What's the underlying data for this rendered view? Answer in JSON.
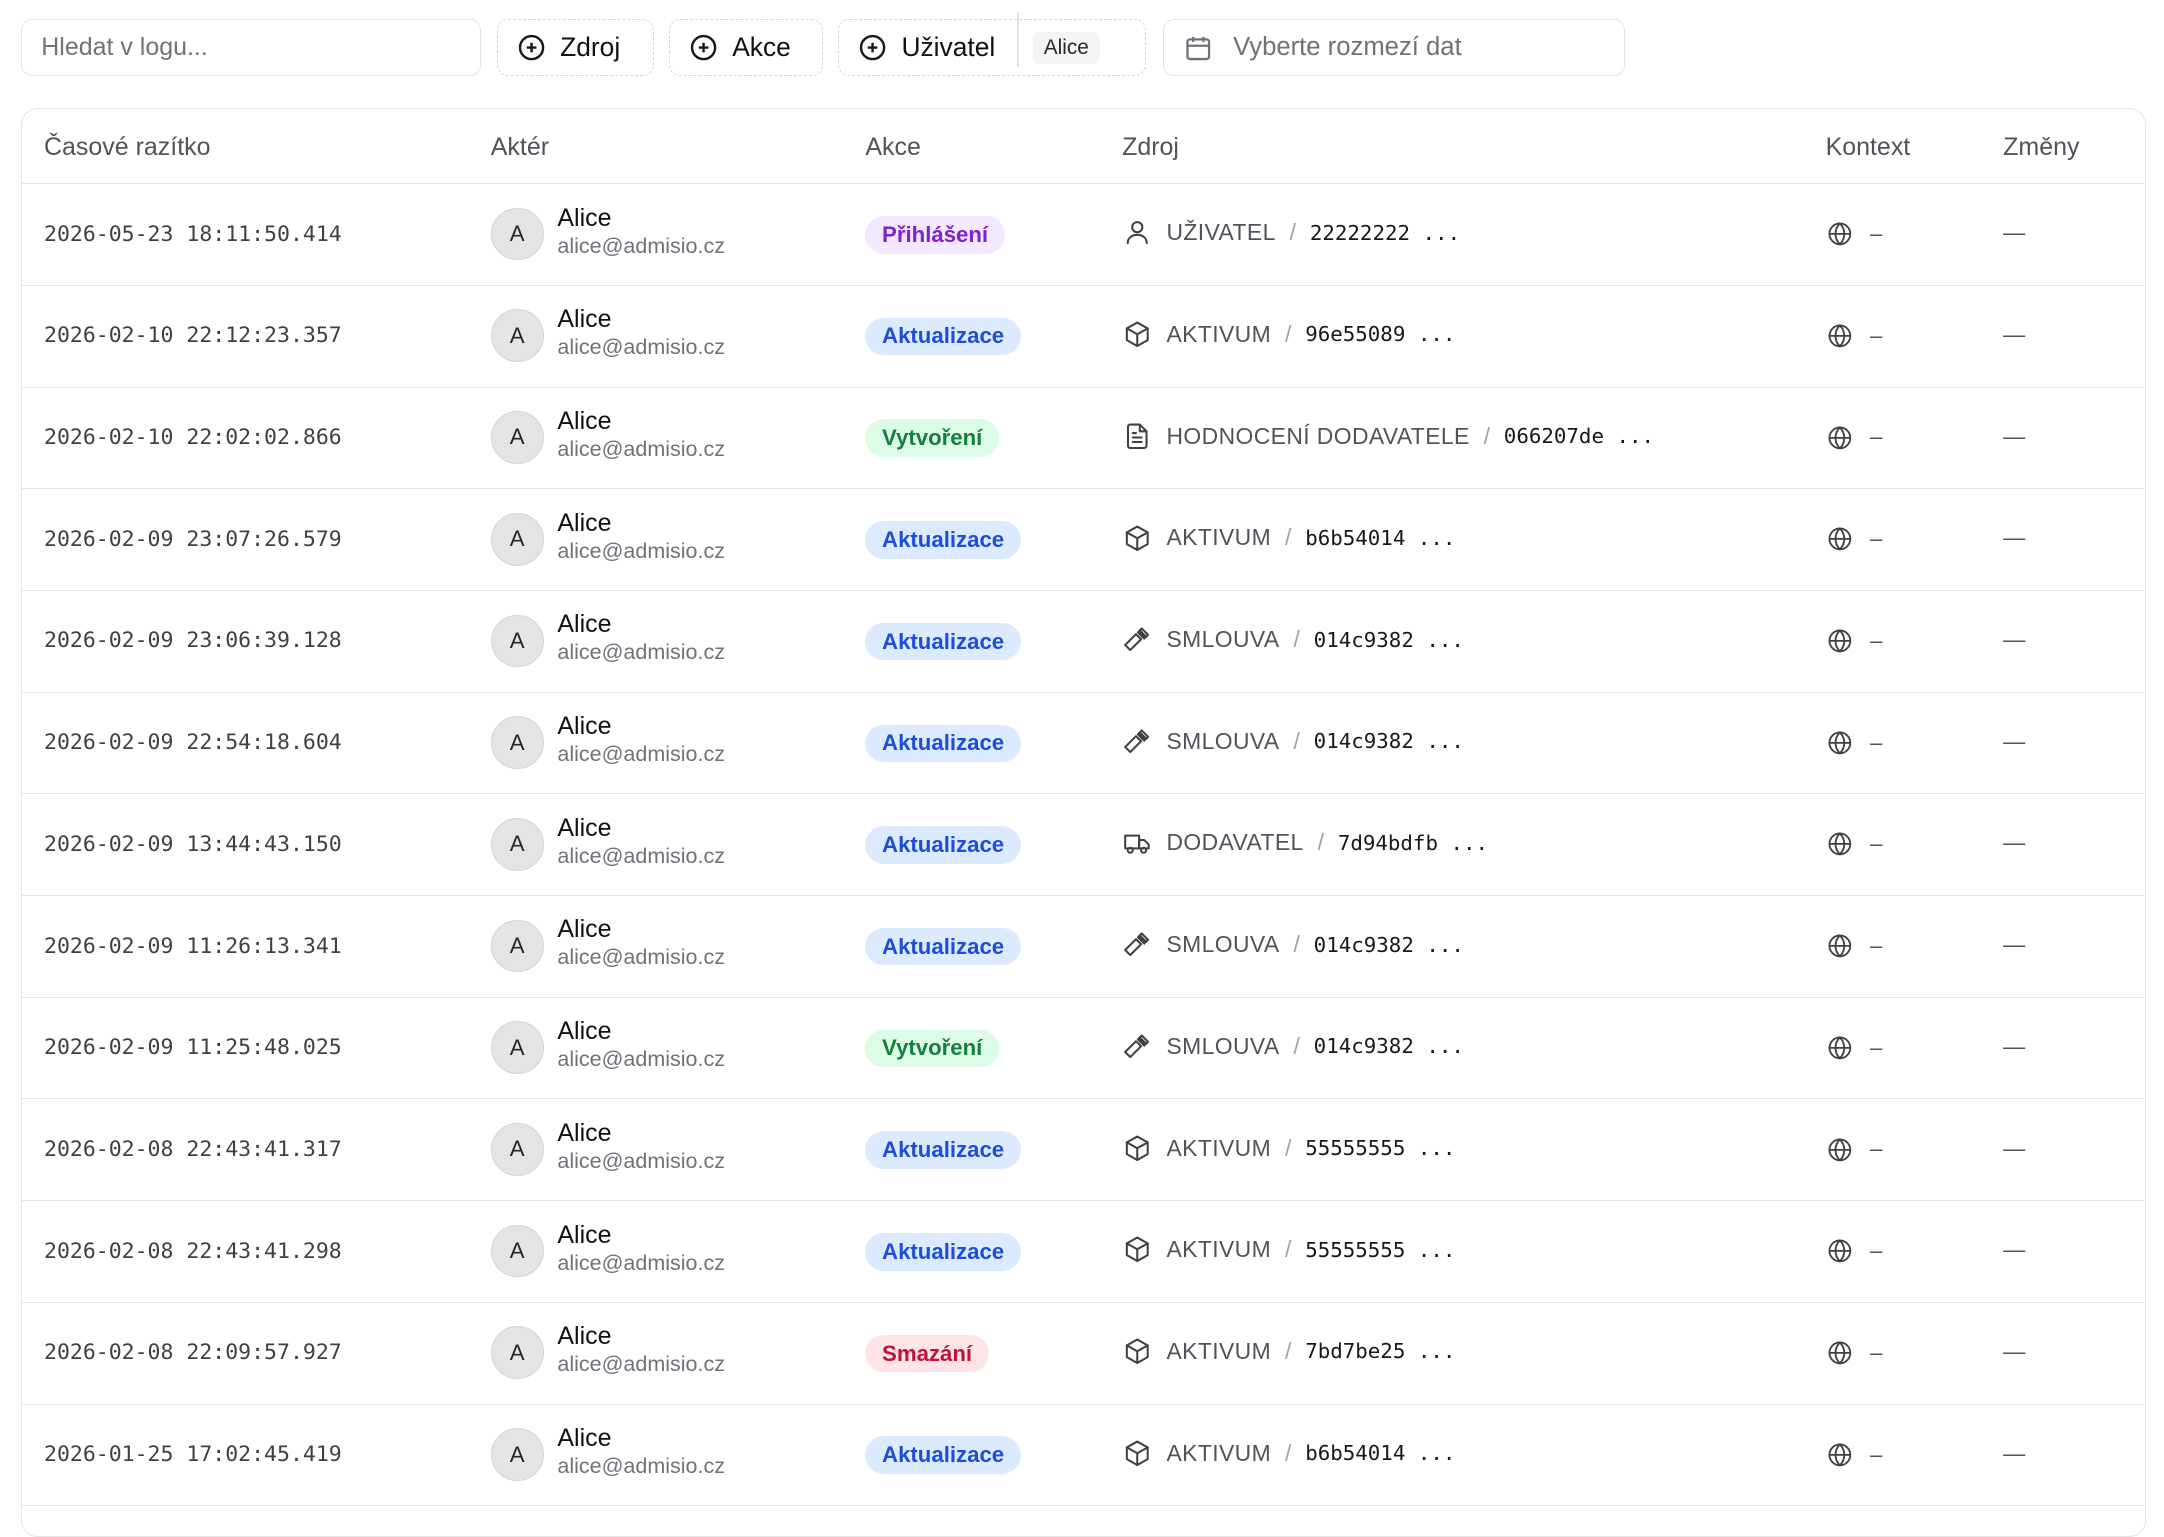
{
  "toolbar": {
    "search_placeholder": "Hledat v logu...",
    "filter_source": "Zdroj",
    "filter_action": "Akce",
    "filter_user": "Uživatel",
    "filter_user_chip": "Alice",
    "date_placeholder": "Vyberte rozmezí dat"
  },
  "table": {
    "columns": [
      "Časové razítko",
      "Aktér",
      "Akce",
      "Zdroj",
      "Kontext",
      "Změny"
    ],
    "rows": [
      {
        "ts": "2026-05-23 18:11:50.414",
        "avatar": "A",
        "name": "Alice",
        "email": "alice@admisio.cz",
        "action": "Přihlášení",
        "kind": "login",
        "icon": "user-icon",
        "type": "UŽIVATEL",
        "id": "22222222 ...",
        "ctx": "–",
        "chg": "—"
      },
      {
        "ts": "2026-02-10 22:12:23.357",
        "avatar": "A",
        "name": "Alice",
        "email": "alice@admisio.cz",
        "action": "Aktualizace",
        "kind": "update",
        "icon": "box-icon",
        "type": "AKTIVUM",
        "id": "96e55089 ...",
        "ctx": "–",
        "chg": "—"
      },
      {
        "ts": "2026-02-10 22:02:02.866",
        "avatar": "A",
        "name": "Alice",
        "email": "alice@admisio.cz",
        "action": "Vytvoření",
        "kind": "create",
        "icon": "document-icon",
        "type": "HODNOCENÍ DODAVATELE",
        "id": "066207de ...",
        "ctx": "–",
        "chg": "—"
      },
      {
        "ts": "2026-02-09 23:07:26.579",
        "avatar": "A",
        "name": "Alice",
        "email": "alice@admisio.cz",
        "action": "Aktualizace",
        "kind": "update",
        "icon": "box-icon",
        "type": "AKTIVUM",
        "id": "b6b54014 ...",
        "ctx": "–",
        "chg": "—"
      },
      {
        "ts": "2026-02-09 23:06:39.128",
        "avatar": "A",
        "name": "Alice",
        "email": "alice@admisio.cz",
        "action": "Aktualizace",
        "kind": "update",
        "icon": "gavel-icon",
        "type": "SMLOUVA",
        "id": "014c9382 ...",
        "ctx": "–",
        "chg": "—"
      },
      {
        "ts": "2026-02-09 22:54:18.604",
        "avatar": "A",
        "name": "Alice",
        "email": "alice@admisio.cz",
        "action": "Aktualizace",
        "kind": "update",
        "icon": "gavel-icon",
        "type": "SMLOUVA",
        "id": "014c9382 ...",
        "ctx": "–",
        "chg": "—"
      },
      {
        "ts": "2026-02-09 13:44:43.150",
        "avatar": "A",
        "name": "Alice",
        "email": "alice@admisio.cz",
        "action": "Aktualizace",
        "kind": "update",
        "icon": "truck-icon",
        "type": "DODAVATEL",
        "id": "7d94bdfb ...",
        "ctx": "–",
        "chg": "—"
      },
      {
        "ts": "2026-02-09 11:26:13.341",
        "avatar": "A",
        "name": "Alice",
        "email": "alice@admisio.cz",
        "action": "Aktualizace",
        "kind": "update",
        "icon": "gavel-icon",
        "type": "SMLOUVA",
        "id": "014c9382 ...",
        "ctx": "–",
        "chg": "—"
      },
      {
        "ts": "2026-02-09 11:25:48.025",
        "avatar": "A",
        "name": "Alice",
        "email": "alice@admisio.cz",
        "action": "Vytvoření",
        "kind": "create",
        "icon": "gavel-icon",
        "type": "SMLOUVA",
        "id": "014c9382 ...",
        "ctx": "–",
        "chg": "—"
      },
      {
        "ts": "2026-02-08 22:43:41.317",
        "avatar": "A",
        "name": "Alice",
        "email": "alice@admisio.cz",
        "action": "Aktualizace",
        "kind": "update",
        "icon": "box-icon",
        "type": "AKTIVUM",
        "id": "55555555 ...",
        "ctx": "–",
        "chg": "—"
      },
      {
        "ts": "2026-02-08 22:43:41.298",
        "avatar": "A",
        "name": "Alice",
        "email": "alice@admisio.cz",
        "action": "Aktualizace",
        "kind": "update",
        "icon": "box-icon",
        "type": "AKTIVUM",
        "id": "55555555 ...",
        "ctx": "–",
        "chg": "—"
      },
      {
        "ts": "2026-02-08 22:09:57.927",
        "avatar": "A",
        "name": "Alice",
        "email": "alice@admisio.cz",
        "action": "Smazání",
        "kind": "delete",
        "icon": "box-icon",
        "type": "AKTIVUM",
        "id": "7bd7be25 ...",
        "ctx": "–",
        "chg": "—"
      },
      {
        "ts": "2026-01-25 17:02:45.419",
        "avatar": "A",
        "name": "Alice",
        "email": "alice@admisio.cz",
        "action": "Aktualizace",
        "kind": "update",
        "icon": "box-icon",
        "type": "AKTIVUM",
        "id": "b6b54014 ...",
        "ctx": "–",
        "chg": "—"
      }
    ]
  }
}
